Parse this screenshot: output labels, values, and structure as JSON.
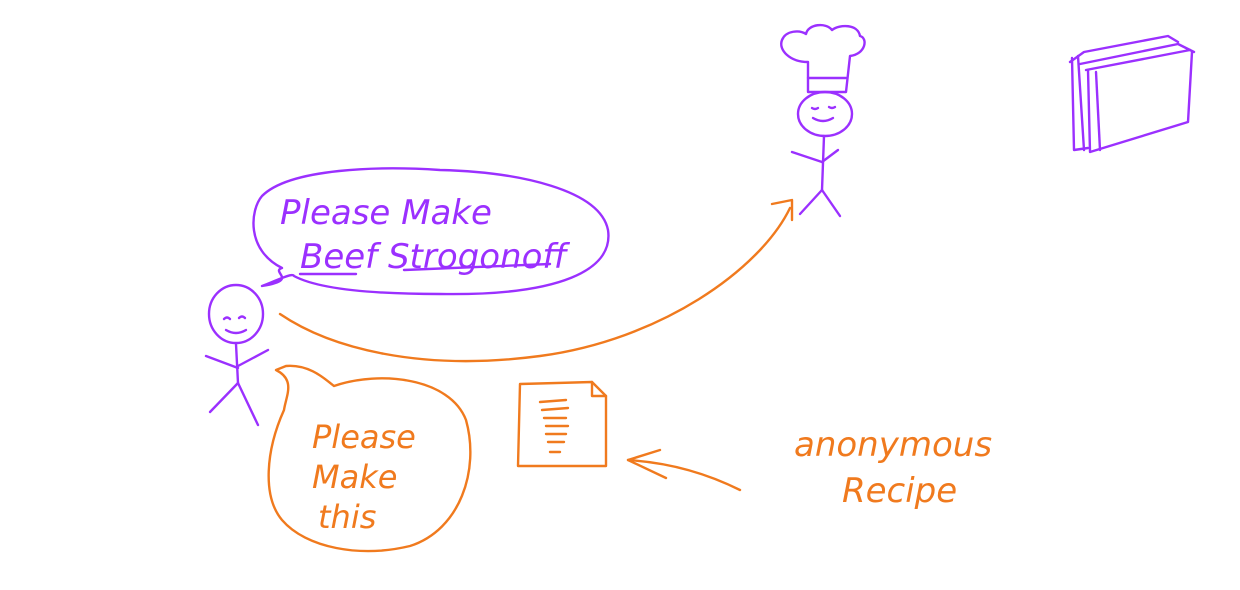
{
  "colors": {
    "purple": "#9b30ff",
    "orange": "#f07a1e",
    "background": "#ffffff"
  },
  "bubble_customer": {
    "line1": "Please Make",
    "line2": "Beef Strogonoff"
  },
  "bubble_recipe": {
    "line1": "Please",
    "line2": "Make",
    "line3": "this"
  },
  "anonymous_label": {
    "line1": "anonymous",
    "line2": "Recipe"
  },
  "icons": {
    "customer": "stick-figure",
    "chef": "chef-stick-figure",
    "book": "book-icon",
    "recipe": "document-icon"
  }
}
